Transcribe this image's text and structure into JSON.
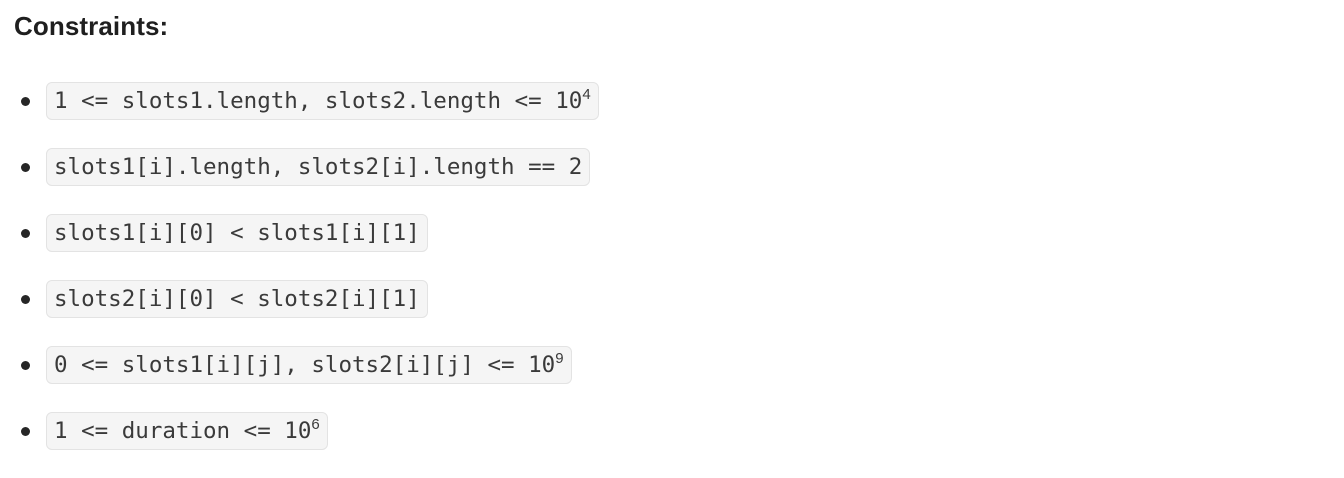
{
  "heading": "Constraints:",
  "constraints": [
    {
      "text": "1 <= slots1.length, slots2.length <= 10",
      "sup": "4"
    },
    {
      "text": "slots1[i].length, slots2[i].length == 2",
      "sup": ""
    },
    {
      "text": "slots1[i][0] < slots1[i][1]",
      "sup": ""
    },
    {
      "text": "slots2[i][0] < slots2[i][1]",
      "sup": ""
    },
    {
      "text": "0 <= slots1[i][j], slots2[i][j] <= 10",
      "sup": "9"
    },
    {
      "text": "1 <= duration <= 10",
      "sup": "6"
    }
  ]
}
